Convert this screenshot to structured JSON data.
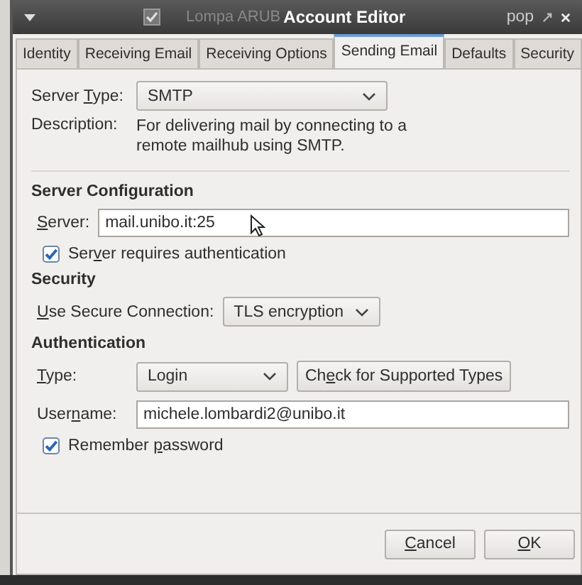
{
  "background_window": {
    "checked": true,
    "title": "Lompa ARUB",
    "label": "pop"
  },
  "window": {
    "title": "Account Editor"
  },
  "tabs": [
    {
      "label": "Identity",
      "selected": false
    },
    {
      "label": "Receiving Email",
      "selected": false
    },
    {
      "label": "Receiving Options",
      "selected": false
    },
    {
      "label": "Sending Email",
      "selected": true
    },
    {
      "label": "Defaults",
      "selected": false
    },
    {
      "label": "Security",
      "selected": false
    }
  ],
  "server_type": {
    "label": {
      "pre": "Server ",
      "key": "T",
      "post": "ype:"
    },
    "value": "SMTP"
  },
  "description": {
    "label": "Description:",
    "text": "For delivering mail by connecting to a remote mailhub using SMTP."
  },
  "sections": [
    {
      "title": "Server Configuration",
      "rows": [
        {
          "kind": "field",
          "label": {
            "key": "S",
            "post": "erver:"
          },
          "value": "mail.unibo.it:25"
        },
        {
          "kind": "checkbox",
          "label": {
            "pre": "Ser",
            "key": "v",
            "post": "er requires authentication"
          },
          "checked": true
        }
      ]
    },
    {
      "title": "Security",
      "rows": [
        {
          "kind": "select",
          "label": {
            "key": "U",
            "post": "se Secure Connection:"
          },
          "value": "TLS encryption"
        }
      ]
    },
    {
      "title": "Authentication",
      "rows": [
        {
          "kind": "select",
          "label": {
            "key": "T",
            "post": "ype:"
          },
          "value": "Login",
          "button": {
            "pre": "Ch",
            "key": "e",
            "post": "ck for Supported Types"
          }
        },
        {
          "kind": "field",
          "label": {
            "pre": "User",
            "key": "n",
            "post": "ame:"
          },
          "value": "michele.lombardi2@unibo.it"
        },
        {
          "kind": "checkbox",
          "label": {
            "pre": "Remember ",
            "key": "p",
            "post": "assword"
          },
          "checked": true
        }
      ]
    }
  ],
  "buttons": [
    {
      "key": "C",
      "post": "ancel"
    },
    {
      "key": "O",
      "post": "K"
    }
  ]
}
